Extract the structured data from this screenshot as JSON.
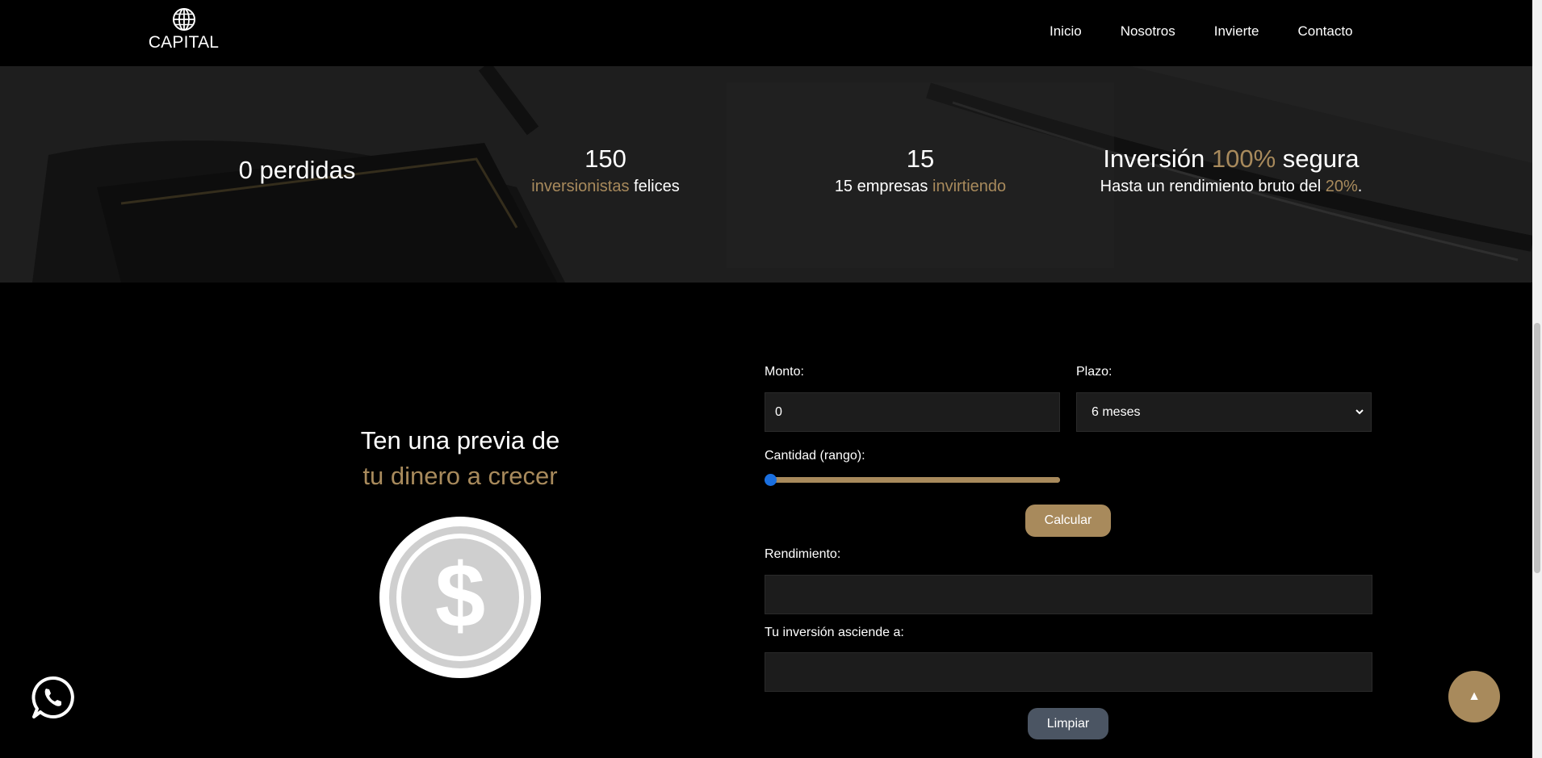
{
  "brand": {
    "name": "CAPITAL",
    "icon": "globe-icon"
  },
  "nav": {
    "items": [
      "Inicio",
      "Nosotros",
      "Invierte",
      "Contacto"
    ]
  },
  "stats": {
    "losses": {
      "value": "0 perdidas"
    },
    "investors": {
      "value": "150",
      "sub_gold": "inversionistas",
      "sub_rest": "felices"
    },
    "companies": {
      "value": "15",
      "sub_rest": "15 empresas",
      "sub_gold": "invirtiendo"
    },
    "secure": {
      "pre": "Inversión",
      "gold": "100%",
      "post": "segura",
      "sub_pre": "Hasta un rendimiento bruto del",
      "sub_gold": "20%",
      "sub_post": "."
    }
  },
  "promo": {
    "line1": "Ten una previa de",
    "line2": "tu dinero a crecer",
    "icon": "dollar-coin-icon"
  },
  "calculator": {
    "amount_label": "Monto:",
    "amount_value": "0",
    "term_label": "Plazo:",
    "term_value": "6 meses",
    "range_label": "Cantidad (rango):",
    "range_value": 0,
    "calc_button": "Calcular",
    "yield_label": "Rendimiento:",
    "yield_value": "",
    "total_label": "Tu inversión asciende a:",
    "total_value": "",
    "clear_button": "Limpiar"
  },
  "floating": {
    "whatsapp_icon": "whatsapp-icon",
    "top_button": "▲"
  },
  "colors": {
    "accent": "#a88a5c",
    "clear_button": "#4b5563",
    "slider_thumb": "#1a6fe0"
  }
}
